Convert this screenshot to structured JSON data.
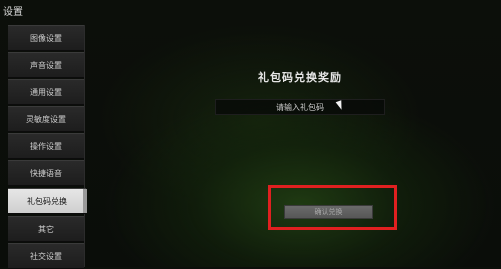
{
  "window": {
    "title": "设置"
  },
  "sidebar": {
    "items": [
      {
        "label": "图像设置",
        "active": false
      },
      {
        "label": "声音设置",
        "active": false
      },
      {
        "label": "通用设置",
        "active": false
      },
      {
        "label": "灵敏度设置",
        "active": false
      },
      {
        "label": "操作设置",
        "active": false
      },
      {
        "label": "快捷语音",
        "active": false
      },
      {
        "label": "礼包码兑换",
        "active": true
      },
      {
        "label": "其它",
        "active": false
      },
      {
        "label": "社交设置",
        "active": false
      }
    ]
  },
  "gift_code": {
    "title": "礼包码兑换奖励",
    "input_placeholder": "请输入礼包码",
    "input_value": "",
    "confirm_label": "确认兑换"
  },
  "colors": {
    "highlight": "#e02020",
    "active_tab": "#e6e6e6"
  }
}
